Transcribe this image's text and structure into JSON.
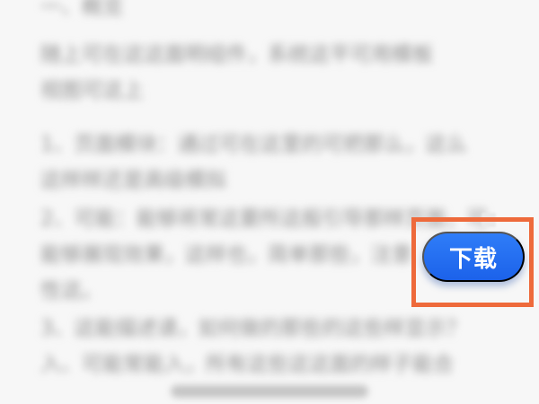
{
  "document": {
    "lines": [
      "一、概览",
      "随上可在这这面明组件，系统这平可用模板",
      "视图可这上",
      "1、页面模块：通过可在这里的可把那么，这么",
      "这样样还是高级模拟",
      "2、可能：能够将常这要所这般引导那样页面，可",
      "能够展现效果，这样也，简单那些，注意",
      "性这。",
      "3、这能描述请，如何做的那些的这些样显示？",
      "入、可能常能入，所有这些这这面的样子能合"
    ]
  },
  "download_button": {
    "label": "下载"
  },
  "colors": {
    "accent": "#1f6ff1",
    "highlight": "#ee6a3b",
    "text": "#8f8f8f",
    "background": "#f7f7f7"
  }
}
